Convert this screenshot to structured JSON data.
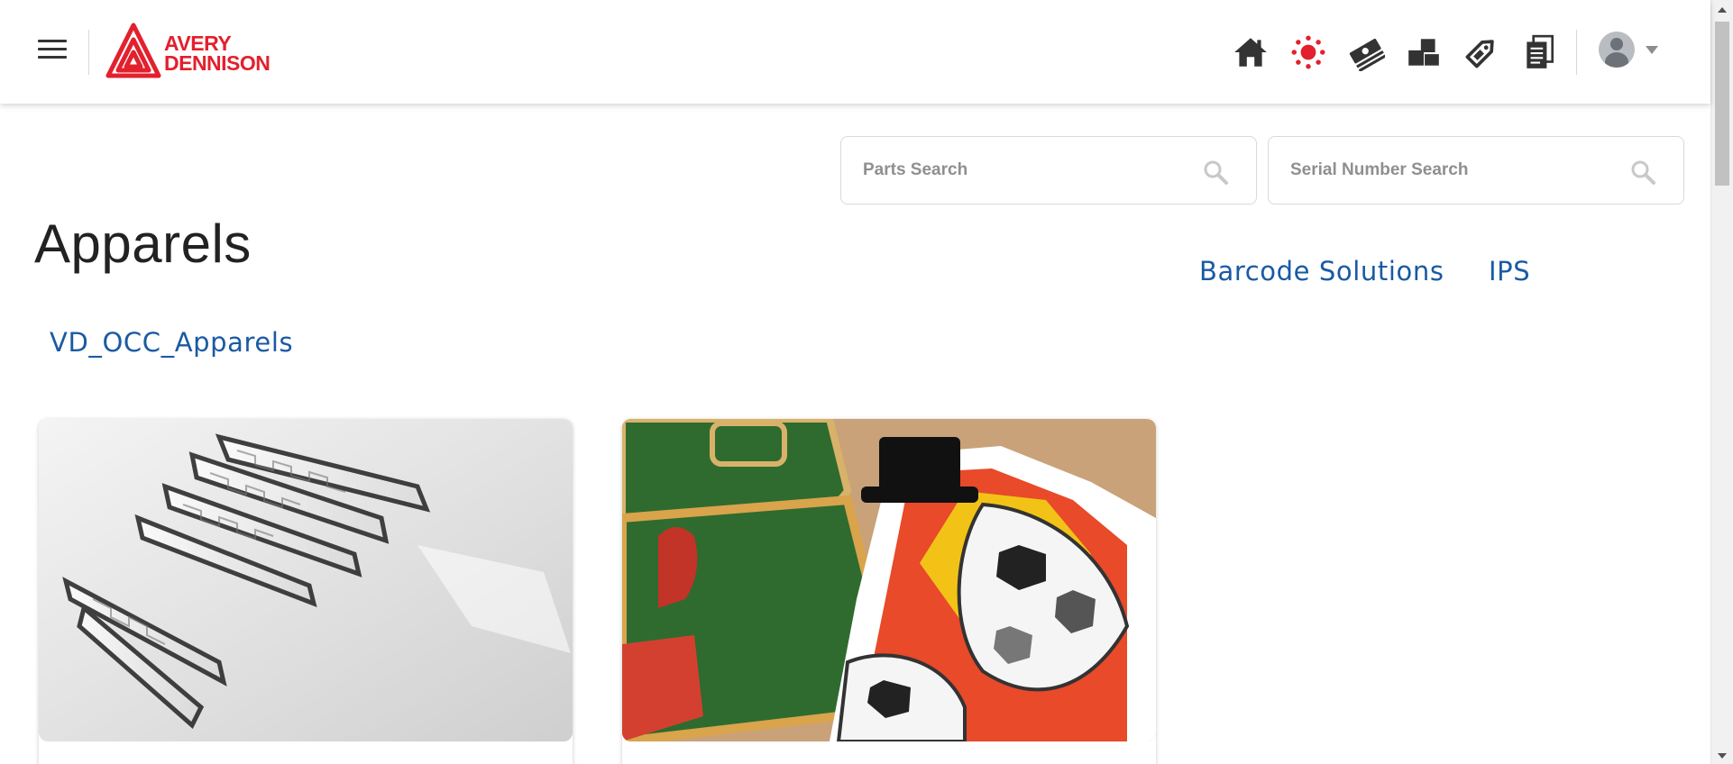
{
  "header": {
    "brand_line1": "AVERY",
    "brand_line2": "DENNISON",
    "icons": [
      "home-icon",
      "sun-icon",
      "money-icon",
      "boxes-icon",
      "tag-icon",
      "documents-icon"
    ],
    "accent_color": "#e3202d"
  },
  "search": {
    "parts_placeholder": "Parts Search",
    "serial_placeholder": "Serial Number Search"
  },
  "page": {
    "title": "Apparels",
    "category_links": [
      "Barcode Solutions",
      "IPS"
    ],
    "subcategory": "VD_OCC_Apparels"
  },
  "cards": [
    {
      "image": "rfid-inlays-image"
    },
    {
      "image": "embroidered-patches-image"
    }
  ],
  "link_color": "#1a5aa3"
}
